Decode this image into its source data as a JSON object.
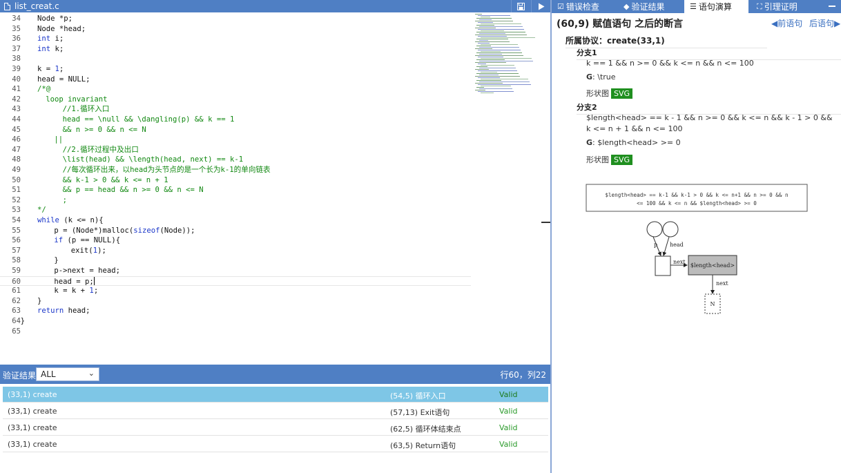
{
  "editor": {
    "file_name": "list_creat.c",
    "current_line": 60,
    "lines": [
      {
        "n": "34",
        "tokens": [
          [
            "p",
            "Node *p;"
          ]
        ],
        "indent": 2
      },
      {
        "n": "35",
        "tokens": [
          [
            "p",
            "Node *head;"
          ]
        ],
        "indent": 2
      },
      {
        "n": "36",
        "tokens": [
          [
            "k",
            "int"
          ],
          [
            "p",
            " i;"
          ]
        ],
        "indent": 2
      },
      {
        "n": "37",
        "tokens": [
          [
            "k",
            "int"
          ],
          [
            "p",
            " k;"
          ]
        ],
        "indent": 2
      },
      {
        "n": "38",
        "tokens": [],
        "indent": 0
      },
      {
        "n": "39",
        "tokens": [
          [
            "p",
            "k = "
          ],
          [
            "n",
            "1"
          ],
          [
            "p",
            ";"
          ]
        ],
        "indent": 2
      },
      {
        "n": "40",
        "tokens": [
          [
            "p",
            "head = NULL;"
          ]
        ],
        "indent": 2
      },
      {
        "n": "41",
        "tokens": [
          [
            "c",
            "/*@"
          ]
        ],
        "indent": 2
      },
      {
        "n": "42",
        "tokens": [
          [
            "c",
            "loop invariant"
          ]
        ],
        "indent": 3
      },
      {
        "n": "43",
        "tokens": [
          [
            "c",
            "//1.循环入口"
          ]
        ],
        "indent": 5
      },
      {
        "n": "44",
        "tokens": [
          [
            "c",
            "head == \\null && \\dangling(p) && k == 1"
          ]
        ],
        "indent": 5
      },
      {
        "n": "45",
        "tokens": [
          [
            "c",
            "&& n >= 0 && n <= N"
          ]
        ],
        "indent": 5
      },
      {
        "n": "46",
        "tokens": [
          [
            "c",
            "||"
          ]
        ],
        "indent": 4
      },
      {
        "n": "47",
        "tokens": [
          [
            "c",
            "//2.循环过程中及出口"
          ]
        ],
        "indent": 5
      },
      {
        "n": "48",
        "tokens": [
          [
            "c",
            "\\list(head) && \\length(head, next) == k-1"
          ]
        ],
        "indent": 5
      },
      {
        "n": "49",
        "tokens": [
          [
            "c",
            "//每次循环出来，以head为头节点的是一个长为k-1的单向链表"
          ]
        ],
        "indent": 5
      },
      {
        "n": "50",
        "tokens": [
          [
            "c",
            "&& k-1 > 0 && k <= n + 1"
          ]
        ],
        "indent": 5
      },
      {
        "n": "51",
        "tokens": [
          [
            "c",
            "&& p == head && n >= 0 && n <= N"
          ]
        ],
        "indent": 5
      },
      {
        "n": "52",
        "tokens": [
          [
            "c",
            ";"
          ]
        ],
        "indent": 5
      },
      {
        "n": "53",
        "tokens": [
          [
            "c",
            "*/"
          ]
        ],
        "indent": 2
      },
      {
        "n": "54",
        "tokens": [
          [
            "k",
            "while"
          ],
          [
            "p",
            " (k <= n){"
          ]
        ],
        "indent": 2
      },
      {
        "n": "55",
        "tokens": [
          [
            "p",
            "p = (Node*)malloc("
          ],
          [
            "k",
            "sizeof"
          ],
          [
            "p",
            "(Node));"
          ]
        ],
        "indent": 4
      },
      {
        "n": "56",
        "tokens": [
          [
            "k",
            "if"
          ],
          [
            "p",
            " (p == NULL){"
          ]
        ],
        "indent": 4
      },
      {
        "n": "57",
        "tokens": [
          [
            "p",
            "exit("
          ],
          [
            "n",
            "1"
          ],
          [
            "p",
            ");"
          ]
        ],
        "indent": 6
      },
      {
        "n": "58",
        "tokens": [
          [
            "p",
            "}"
          ]
        ],
        "indent": 4
      },
      {
        "n": "59",
        "tokens": [
          [
            "p",
            "p->next = head;"
          ]
        ],
        "indent": 4
      },
      {
        "n": "60",
        "tokens": [
          [
            "p",
            "head = p;"
          ]
        ],
        "indent": 4,
        "caret": true
      },
      {
        "n": "61",
        "tokens": [
          [
            "p",
            "k = k + "
          ],
          [
            "n",
            "1"
          ],
          [
            "p",
            ";"
          ]
        ],
        "indent": 4
      },
      {
        "n": "62",
        "tokens": [
          [
            "p",
            "}"
          ]
        ],
        "indent": 2
      },
      {
        "n": "63",
        "tokens": [
          [
            "k",
            "return"
          ],
          [
            "p",
            " head;"
          ]
        ],
        "indent": 2
      },
      {
        "n": "64",
        "tokens": [
          [
            "p",
            "}"
          ]
        ],
        "indent": 0
      },
      {
        "n": "65",
        "tokens": [],
        "indent": 0
      }
    ]
  },
  "results": {
    "label": "验证结果",
    "filter_value": "ALL",
    "cursor_position": "行60，列22",
    "rows": [
      {
        "func": "(33,1) create",
        "point": "(54,5) 循环入口",
        "status": "Valid",
        "selected": true
      },
      {
        "func": "(33,1) create",
        "point": "(57,13) Exit语句",
        "status": "Valid",
        "selected": false
      },
      {
        "func": "(33,1) create",
        "point": "(62,5) 循环体结束点",
        "status": "Valid",
        "selected": false
      },
      {
        "func": "(33,1) create",
        "point": "(63,5) Return语句",
        "status": "Valid",
        "selected": false
      }
    ]
  },
  "right_tabs": [
    {
      "label": "错误检查",
      "icon": "check-square-icon",
      "glyph": "☑",
      "active": false
    },
    {
      "label": "验证结果",
      "icon": "tag-icon",
      "glyph": "◆",
      "active": false
    },
    {
      "label": "语句演算",
      "icon": "list-icon",
      "glyph": "☰",
      "active": true
    },
    {
      "label": "引理证明",
      "icon": "sitemap-icon",
      "glyph": "⛶",
      "active": false
    }
  ],
  "panel": {
    "title": "(60,9) 赋值语句 之后的断言",
    "prev": "◀前语句",
    "next": "后语句▶",
    "protocol": "所属协议：create(33,1)",
    "branches": [
      {
        "title": "分支1",
        "cond": "k == 1 && n >= 0 && k <= n && n <= 100",
        "g_label": "G",
        "g_value": ": \\true",
        "shape_label": "形状图",
        "svg_label": "SVG"
      },
      {
        "title": "分支2",
        "cond": "$length<head> == k - 1 && n >= 0 && k <= n && k - 1 > 0 && k <= n + 1 && n <= 100",
        "g_label": "G",
        "g_value": ": $length<head> >= 0",
        "shape_label": "形状图",
        "svg_label": "SVG"
      }
    ],
    "diagram": {
      "condition_line1": "$length<head> == k-1 && k-1 > 0 && k <= n+1 && n >= 0 && n",
      "condition_line2": "<= 100 && k <= n && $length<head> >= 0",
      "var_p": "p",
      "var_head": "head",
      "edge_next_1": "next",
      "edge_next_2": "next",
      "list_node": "$length<head>",
      "null_node": "N"
    }
  },
  "colors": {
    "accent": "#4f7fc4",
    "selected_row": "#7ec6e6",
    "valid": "#2a9a2a",
    "svg_badge": "#1f8f1f"
  }
}
